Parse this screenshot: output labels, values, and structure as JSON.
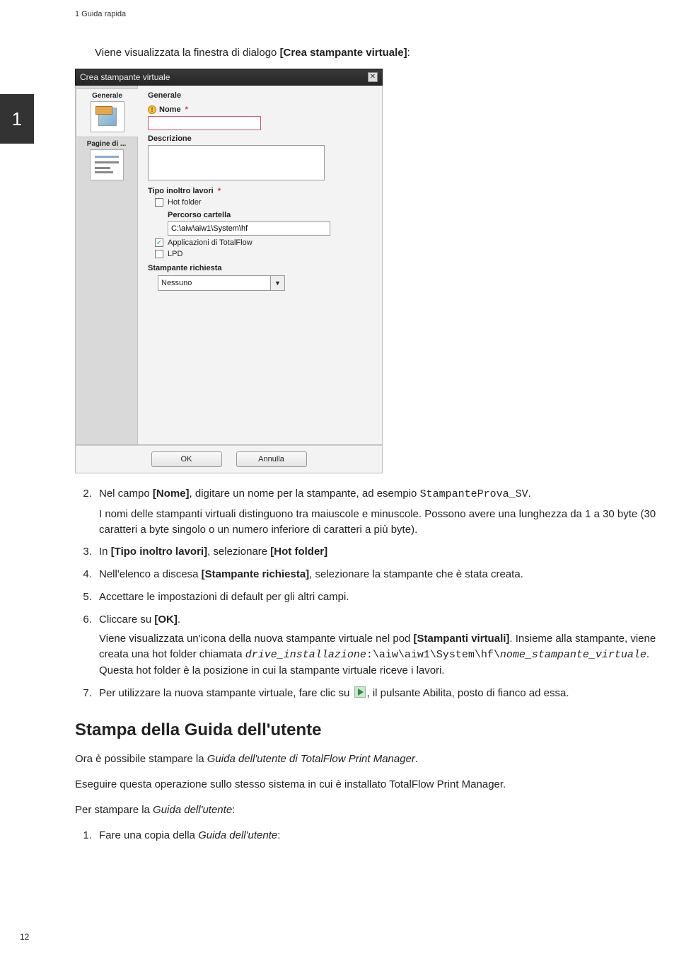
{
  "header": {
    "running_title": "1 Guida rapida"
  },
  "chapter_tab": "1",
  "intro": {
    "before_bold": "Viene visualizzata la finestra di dialogo ",
    "bold": "[Crea stampante virtuale]",
    "after_bold": ":"
  },
  "dialog": {
    "title": "Crea stampante virtuale",
    "sidebar_tab1": "Generale",
    "sidebar_tab2": "Pagine di ...",
    "section_header": "Generale",
    "name_label": "Nome",
    "desc_label": "Descrizione",
    "tipo_label": "Tipo inoltro lavori",
    "hotfolder_label": "Hot folder",
    "path_label": "Percorso cartella",
    "path_value": "C:\\aiw\\aiw1\\System\\hf",
    "apps_label": "Applicazioni di TotalFlow",
    "lpd_label": "LPD",
    "requested_printer_label": "Stampante richiesta",
    "requested_printer_value": "Nessuno",
    "ok": "OK",
    "cancel": "Annulla"
  },
  "steps": {
    "s2_a": "Nel campo ",
    "s2_b": "[Nome]",
    "s2_c": ", digitare un nome per la stampante, ad esempio ",
    "s2_d": "StampanteProva_SV",
    "s2_e": ".",
    "s2_sub": "I nomi delle stampanti virtuali distinguono tra maiuscole e minuscole. Possono avere una lunghezza da 1 a 30 byte (30 caratteri a byte singolo o un numero inferiore di caratteri a più byte).",
    "s3_a": "In ",
    "s3_b": "[Tipo inoltro lavori]",
    "s3_c": ", selezionare ",
    "s3_d": "[Hot folder]",
    "s4_a": "Nell'elenco a discesa ",
    "s4_b": "[Stampante richiesta]",
    "s4_c": ", selezionare la stampante che è stata creata.",
    "s5": "Accettare le impostazioni di default per gli altri campi.",
    "s6_a": "Cliccare su ",
    "s6_b": "[OK]",
    "s6_c": ".",
    "s6_sub_a": "Viene visualizzata un'icona della nuova stampante virtuale nel pod ",
    "s6_sub_b": "[Stampanti virtuali]",
    "s6_sub_c": ". Insieme alla stampante, viene creata una hot folder chiamata ",
    "s6_sub_d": "drive_installazione",
    "s6_sub_e": ":\\aiw\\aiw1\\System\\hf\\",
    "s6_sub_f": "nome_stampante_virtuale",
    "s6_sub_g": ". Questa hot folder è la posizione in cui la stampante virtuale riceve i lavori.",
    "s7_a": "Per utilizzare la nuova stampante virtuale, fare clic su ",
    "s7_b": ", il pulsante Abilita, posto di fianco ad essa."
  },
  "section_heading": "Stampa della Guida dell'utente",
  "para1_a": "Ora è possibile stampare la ",
  "para1_b": "Guida dell'utente di TotalFlow Print Manager",
  "para1_c": ".",
  "para2": "Eseguire questa operazione sullo stesso sistema in cui è installato TotalFlow Print Manager.",
  "para3_a": "Per stampare la ",
  "para3_b": "Guida dell'utente",
  "para3_c": ":",
  "print_step1_a": "Fare una copia della ",
  "print_step1_b": "Guida dell'utente",
  "print_step1_c": ":",
  "page_number": "12"
}
